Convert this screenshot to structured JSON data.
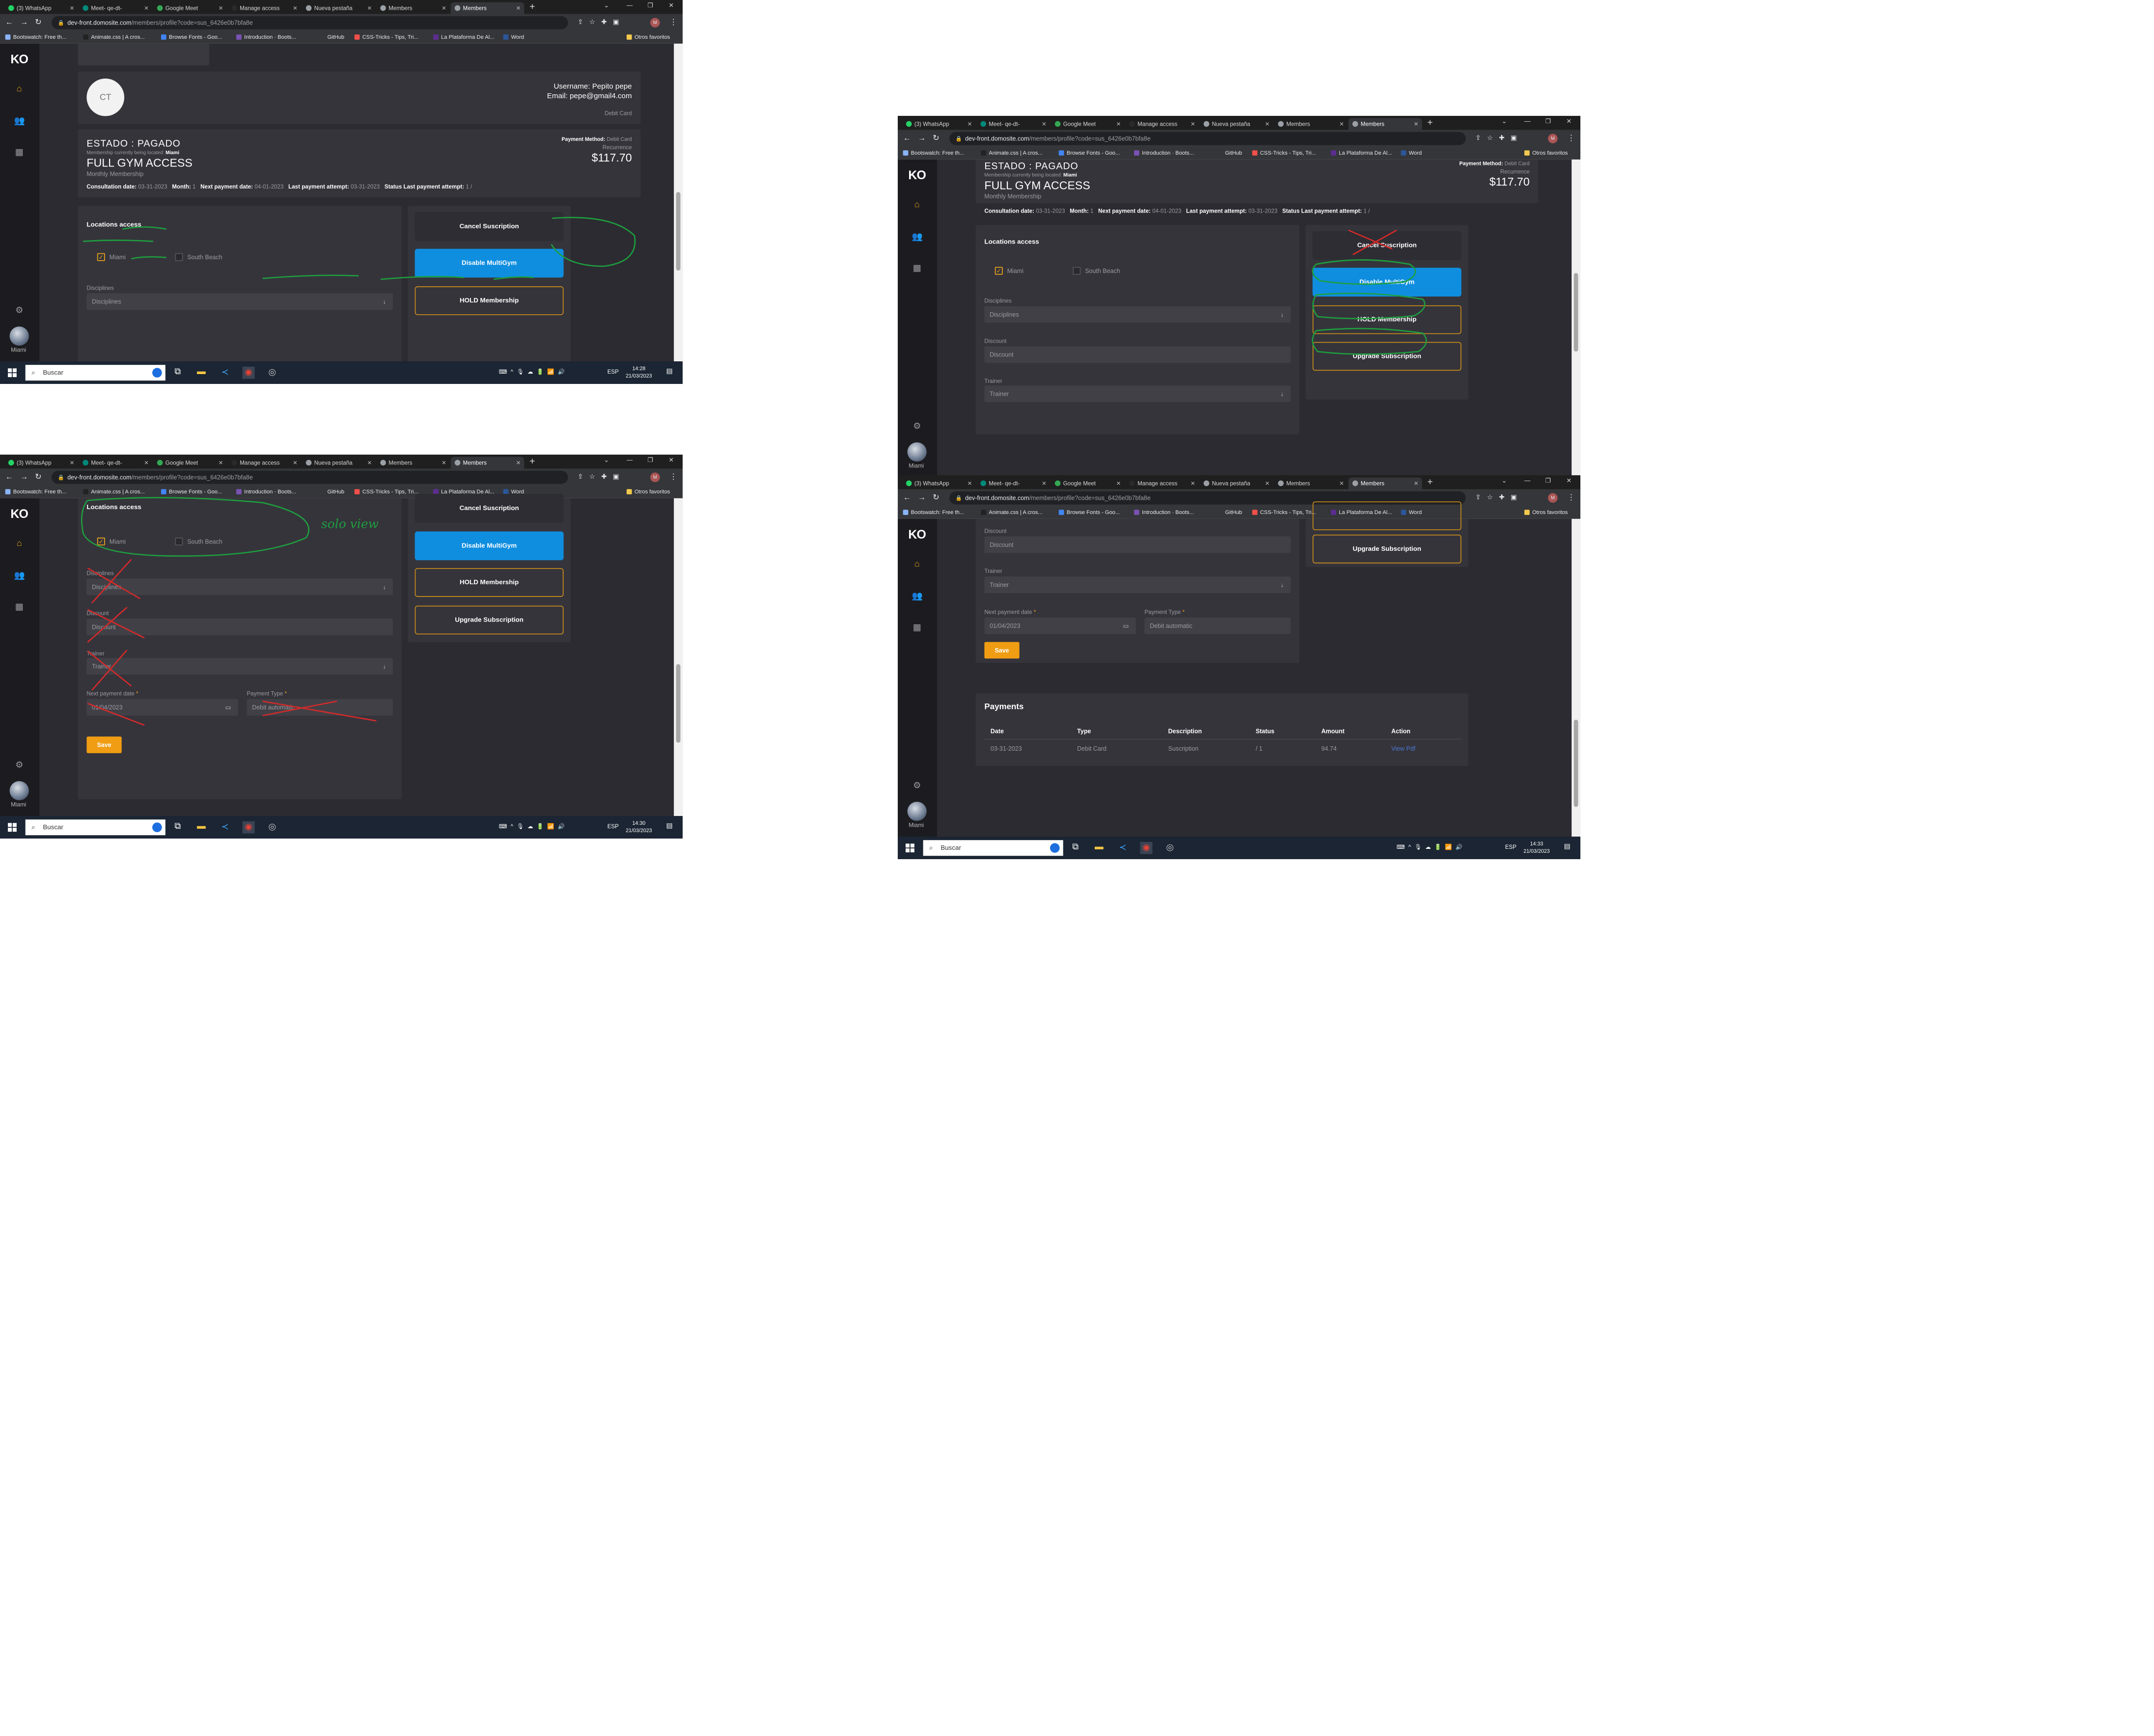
{
  "browser": {
    "tabs": [
      "(3) WhatsApp",
      "Meet- qe-dt-",
      "Google Meet",
      "Manage access",
      "Nueva pestaña",
      "Members",
      "Members"
    ],
    "url_host": "dev-front.domosite.com",
    "url_path": "/members/profile?code=sus_6426e0b7bfa8e",
    "bookmarks": [
      "Bootswatch: Free th...",
      "Animate.css | A cros...",
      "Browse Fonts - Goo...",
      "Introduction · Boots...",
      "GitHub",
      "CSS-Tricks - Tips, Tri...",
      "La Plataforma De Al...",
      "Word"
    ],
    "other_bookmarks": "Otros favoritos"
  },
  "sidebar": {
    "logo": "KO",
    "location": "Miami"
  },
  "profile": {
    "initials": "CT",
    "username": "Username: Pepito pepe",
    "email": "Email: pepe@gmail4.com",
    "payment_type": "Debit Card"
  },
  "subscription": {
    "status": "ESTADO : PAGADO",
    "location_line_label": "Membership currently being located",
    "location_value": "Miami",
    "plan": "FULL GYM ACCESS",
    "plan_type": "Monthly Membership",
    "payment_method_label": "Payment Method:",
    "payment_method_value": "Debit Card",
    "recurrence_label": "Recurrence",
    "amount": "$117.70",
    "consultation_label": "Consultation date:",
    "consultation_value": "03-31-2023",
    "month_label": "Month:",
    "month_value": "1",
    "next_payment_label": "Next payment date:",
    "next_payment_value": "04-01-2023",
    "last_attempt_label": "Last payment attempt:",
    "last_attempt_value": "03-31-2023",
    "status_last_label": "Status Last payment attempt:",
    "status_last_value": "1 /"
  },
  "locations": {
    "title": "Locations access",
    "options": [
      {
        "label": "Miami",
        "checked": true
      },
      {
        "label": "South Beach",
        "checked": false
      }
    ]
  },
  "form": {
    "disciplines_label": "Disciplines",
    "disciplines_placeholder": "Disciplines",
    "discount_label": "Discount",
    "discount_placeholder": "Discount",
    "trainer_label": "Trainer",
    "trainer_placeholder": "Trainer",
    "next_payment_label": "Next payment date",
    "next_payment_value": "01/04/2023",
    "payment_type_label": "Payment Type",
    "payment_type_value": "Debit automatic",
    "required_mark": "*",
    "save": "Save"
  },
  "actions": {
    "cancel": "Cancel Suscription",
    "disable": "Disable MultiGym",
    "hold": "HOLD Membership",
    "upgrade": "Upgrade Subscription"
  },
  "payments": {
    "title": "Payments",
    "columns": [
      "Date",
      "Type",
      "Description",
      "Status",
      "Amount",
      "Action"
    ],
    "rows": [
      [
        "03-31-2023",
        "Debit Card",
        "Suscription",
        "/ 1",
        "94.74",
        "View Pdf"
      ]
    ]
  },
  "annotation": {
    "note": "solo view"
  },
  "taskbar": {
    "search": "Buscar",
    "lang": "ESP",
    "clocks": [
      {
        "time": "14:28",
        "date": "21/03/2023"
      },
      {
        "time": "14:30",
        "date": "21/03/2023"
      },
      {
        "time": "14:32",
        "date": "21/03/2023"
      },
      {
        "time": "14:33",
        "date": "21/03/2023"
      }
    ]
  },
  "colors": {
    "accent": "#e8a11a",
    "primary_button": "#0f8ee0",
    "background": "#2c2b31",
    "card": "#35343b",
    "annotation_green": "#1e9e3e",
    "annotation_red": "#d42a2a"
  }
}
